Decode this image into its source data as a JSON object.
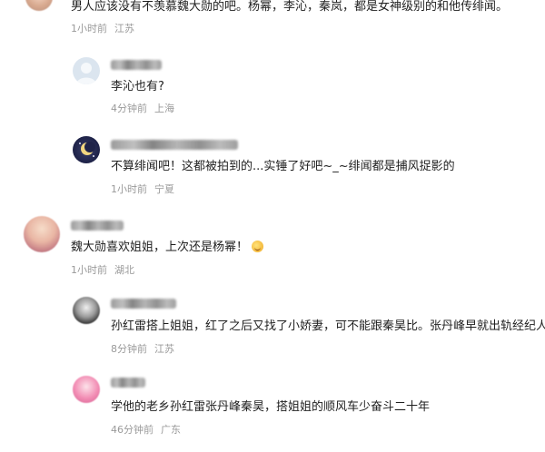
{
  "comments": [
    {
      "text": "男人应该没有不羡慕魏大勋的吧。杨幂，李沁，秦岚，都是女神级别的和他传绯闻。",
      "time": "1小时前",
      "location": "江苏"
    },
    {
      "text": "李沁也有?",
      "time": "4分钟前",
      "location": "上海"
    },
    {
      "text": "不算绯闻吧！这都被拍到的...实锤了好吧~_~绯闻都是捕风捉影的",
      "time": "1小时前",
      "location": "宁夏"
    },
    {
      "text": "魏大勋喜欢姐姐，上次还是杨幂！",
      "time": "1小时前",
      "location": "湖北"
    },
    {
      "text": "孙红雷搭上姐姐，红了之后又找了小娇妻，可不能跟秦昊比。张丹峰早就出轨经纪人了",
      "time": "8分钟前",
      "location": "江苏"
    },
    {
      "text": "学他的老乡孙红雷张丹峰秦昊，搭姐姐的顺风车少奋斗二十年",
      "time": "46分钟前",
      "location": "广东"
    }
  ],
  "icons": {
    "comment_3_emoji": "grinning-emoji"
  }
}
